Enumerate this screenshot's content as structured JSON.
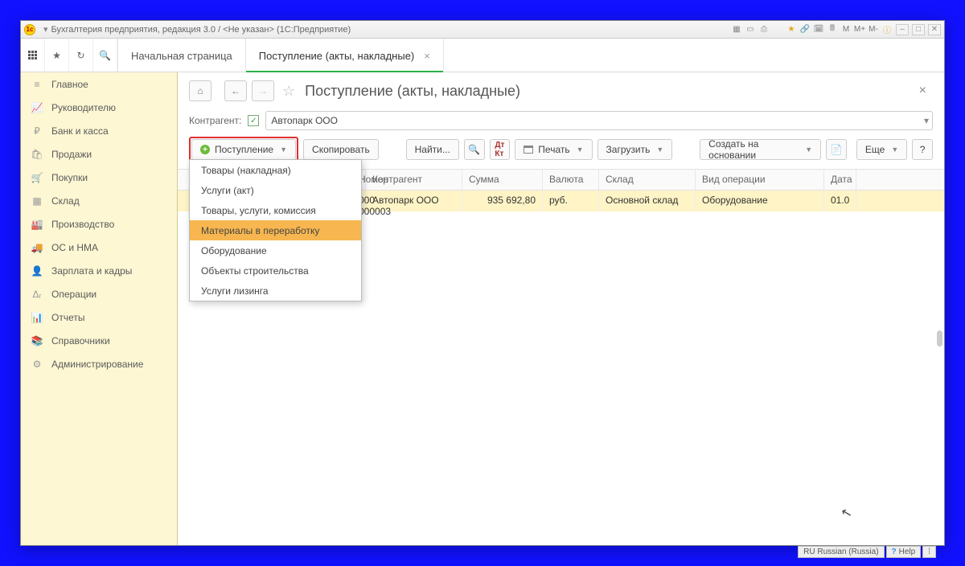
{
  "title": "Бухгалтерия предприятия, редакция 3.0 / <Не указан>  (1С:Предприятие)",
  "sys_m": [
    "M",
    "M+",
    "M-"
  ],
  "tabs": {
    "home": "Начальная страница",
    "active": "Поступление (акты, накладные)"
  },
  "sidebar": {
    "items": [
      {
        "icon": "≡",
        "label": "Главное"
      },
      {
        "icon": "📈",
        "label": "Руководителю"
      },
      {
        "icon": "₽",
        "label": "Банк и касса"
      },
      {
        "icon": "🛍",
        "label": "Продажи"
      },
      {
        "icon": "🛒",
        "label": "Покупки"
      },
      {
        "icon": "▦",
        "label": "Склад"
      },
      {
        "icon": "🏭",
        "label": "Производство"
      },
      {
        "icon": "🚚",
        "label": "ОС и НМА"
      },
      {
        "icon": "👤",
        "label": "Зарплата и кадры"
      },
      {
        "icon": "Δᵣ",
        "label": "Операции"
      },
      {
        "icon": "📊",
        "label": "Отчеты"
      },
      {
        "icon": "📚",
        "label": "Справочники"
      },
      {
        "icon": "⚙",
        "label": "Администрирование"
      }
    ]
  },
  "page_title": "Поступление (акты, накладные)",
  "filter_label": "Контрагент:",
  "filter_value": "Автопарк ООО",
  "toolbar": {
    "create": "Поступление",
    "copy": "Скопировать",
    "find": "Найти...",
    "print": "Печать",
    "load": "Загрузить",
    "based": "Создать на основании",
    "more": "Еще",
    "help": "?"
  },
  "dropdown": {
    "items": [
      "Товары (накладная)",
      "Услуги (акт)",
      "Товары, услуги, комиссия",
      "Материалы в переработку",
      "Оборудование",
      "Объекты строительства",
      "Услуги лизинга"
    ],
    "hover_index": 3
  },
  "columns": {
    "num": "Номер",
    "ctr": "Контрагент",
    "sum": "Сумма",
    "cur": "Валюта",
    "wh": "Склад",
    "op": "Вид операции",
    "date": "Дата"
  },
  "rows": [
    {
      "num": "000-000003",
      "ctr": "Автопарк ООО",
      "sum": "935 692,80",
      "cur": "руб.",
      "wh": "Основной склад",
      "op": "Оборудование",
      "date": "01.0"
    }
  ],
  "status": {
    "lang": "RU Russian (Russia)",
    "help": "Help"
  }
}
